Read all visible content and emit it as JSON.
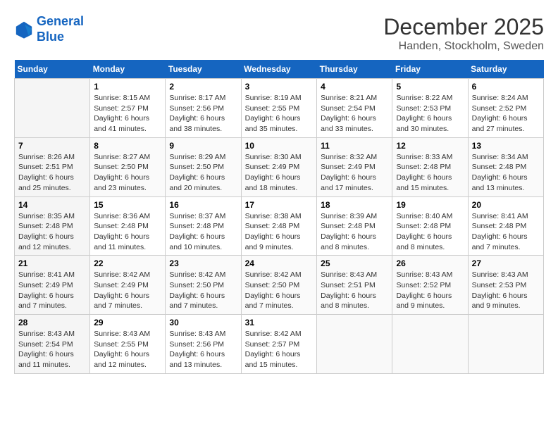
{
  "header": {
    "logo_line1": "General",
    "logo_line2": "Blue",
    "title": "December 2025",
    "subtitle": "Handen, Stockholm, Sweden"
  },
  "calendar": {
    "days_of_week": [
      "Sunday",
      "Monday",
      "Tuesday",
      "Wednesday",
      "Thursday",
      "Friday",
      "Saturday"
    ],
    "weeks": [
      [
        {
          "day": "",
          "info": ""
        },
        {
          "day": "1",
          "info": "Sunrise: 8:15 AM\nSunset: 2:57 PM\nDaylight: 6 hours\nand 41 minutes."
        },
        {
          "day": "2",
          "info": "Sunrise: 8:17 AM\nSunset: 2:56 PM\nDaylight: 6 hours\nand 38 minutes."
        },
        {
          "day": "3",
          "info": "Sunrise: 8:19 AM\nSunset: 2:55 PM\nDaylight: 6 hours\nand 35 minutes."
        },
        {
          "day": "4",
          "info": "Sunrise: 8:21 AM\nSunset: 2:54 PM\nDaylight: 6 hours\nand 33 minutes."
        },
        {
          "day": "5",
          "info": "Sunrise: 8:22 AM\nSunset: 2:53 PM\nDaylight: 6 hours\nand 30 minutes."
        },
        {
          "day": "6",
          "info": "Sunrise: 8:24 AM\nSunset: 2:52 PM\nDaylight: 6 hours\nand 27 minutes."
        }
      ],
      [
        {
          "day": "7",
          "info": "Sunrise: 8:26 AM\nSunset: 2:51 PM\nDaylight: 6 hours\nand 25 minutes."
        },
        {
          "day": "8",
          "info": "Sunrise: 8:27 AM\nSunset: 2:50 PM\nDaylight: 6 hours\nand 23 minutes."
        },
        {
          "day": "9",
          "info": "Sunrise: 8:29 AM\nSunset: 2:50 PM\nDaylight: 6 hours\nand 20 minutes."
        },
        {
          "day": "10",
          "info": "Sunrise: 8:30 AM\nSunset: 2:49 PM\nDaylight: 6 hours\nand 18 minutes."
        },
        {
          "day": "11",
          "info": "Sunrise: 8:32 AM\nSunset: 2:49 PM\nDaylight: 6 hours\nand 17 minutes."
        },
        {
          "day": "12",
          "info": "Sunrise: 8:33 AM\nSunset: 2:48 PM\nDaylight: 6 hours\nand 15 minutes."
        },
        {
          "day": "13",
          "info": "Sunrise: 8:34 AM\nSunset: 2:48 PM\nDaylight: 6 hours\nand 13 minutes."
        }
      ],
      [
        {
          "day": "14",
          "info": "Sunrise: 8:35 AM\nSunset: 2:48 PM\nDaylight: 6 hours\nand 12 minutes."
        },
        {
          "day": "15",
          "info": "Sunrise: 8:36 AM\nSunset: 2:48 PM\nDaylight: 6 hours\nand 11 minutes."
        },
        {
          "day": "16",
          "info": "Sunrise: 8:37 AM\nSunset: 2:48 PM\nDaylight: 6 hours\nand 10 minutes."
        },
        {
          "day": "17",
          "info": "Sunrise: 8:38 AM\nSunset: 2:48 PM\nDaylight: 6 hours\nand 9 minutes."
        },
        {
          "day": "18",
          "info": "Sunrise: 8:39 AM\nSunset: 2:48 PM\nDaylight: 6 hours\nand 8 minutes."
        },
        {
          "day": "19",
          "info": "Sunrise: 8:40 AM\nSunset: 2:48 PM\nDaylight: 6 hours\nand 8 minutes."
        },
        {
          "day": "20",
          "info": "Sunrise: 8:41 AM\nSunset: 2:48 PM\nDaylight: 6 hours\nand 7 minutes."
        }
      ],
      [
        {
          "day": "21",
          "info": "Sunrise: 8:41 AM\nSunset: 2:49 PM\nDaylight: 6 hours\nand 7 minutes."
        },
        {
          "day": "22",
          "info": "Sunrise: 8:42 AM\nSunset: 2:49 PM\nDaylight: 6 hours\nand 7 minutes."
        },
        {
          "day": "23",
          "info": "Sunrise: 8:42 AM\nSunset: 2:50 PM\nDaylight: 6 hours\nand 7 minutes."
        },
        {
          "day": "24",
          "info": "Sunrise: 8:42 AM\nSunset: 2:50 PM\nDaylight: 6 hours\nand 7 minutes."
        },
        {
          "day": "25",
          "info": "Sunrise: 8:43 AM\nSunset: 2:51 PM\nDaylight: 6 hours\nand 8 minutes."
        },
        {
          "day": "26",
          "info": "Sunrise: 8:43 AM\nSunset: 2:52 PM\nDaylight: 6 hours\nand 9 minutes."
        },
        {
          "day": "27",
          "info": "Sunrise: 8:43 AM\nSunset: 2:53 PM\nDaylight: 6 hours\nand 9 minutes."
        }
      ],
      [
        {
          "day": "28",
          "info": "Sunrise: 8:43 AM\nSunset: 2:54 PM\nDaylight: 6 hours\nand 11 minutes."
        },
        {
          "day": "29",
          "info": "Sunrise: 8:43 AM\nSunset: 2:55 PM\nDaylight: 6 hours\nand 12 minutes."
        },
        {
          "day": "30",
          "info": "Sunrise: 8:43 AM\nSunset: 2:56 PM\nDaylight: 6 hours\nand 13 minutes."
        },
        {
          "day": "31",
          "info": "Sunrise: 8:42 AM\nSunset: 2:57 PM\nDaylight: 6 hours\nand 15 minutes."
        },
        {
          "day": "",
          "info": ""
        },
        {
          "day": "",
          "info": ""
        },
        {
          "day": "",
          "info": ""
        }
      ]
    ]
  }
}
